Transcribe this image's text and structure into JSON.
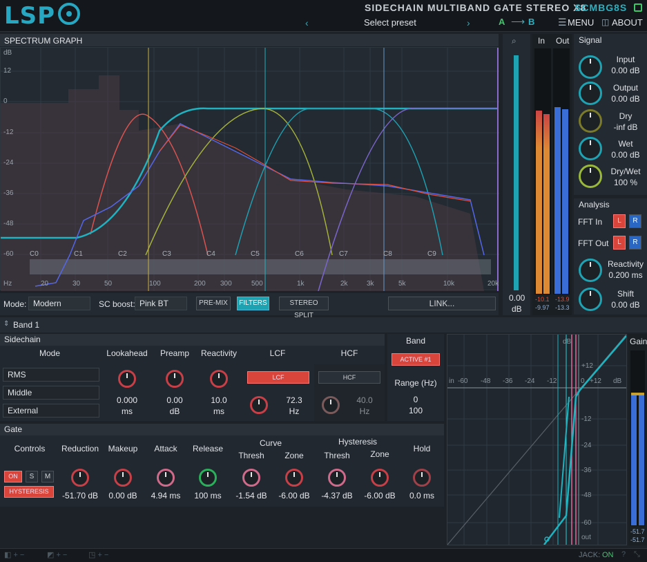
{
  "header": {
    "logo": "LSP",
    "title": "SIDECHAIN MULTIBAND GATE STEREO X8",
    "code": "SCMBG8S",
    "preset": "Select preset",
    "a": "A",
    "b": "B",
    "menu": "MENU",
    "about": "ABOUT"
  },
  "graph": {
    "title": "SPECTRUM GRAPH",
    "db_labels": [
      "dB",
      "12",
      "0",
      "-12",
      "-24",
      "-36",
      "-48",
      "-60"
    ],
    "freq_labels": [
      "Hz",
      "20",
      "30",
      "50",
      "100",
      "200",
      "300",
      "500",
      "1k",
      "2k",
      "3k",
      "5k",
      "10k",
      "20k"
    ],
    "notes": [
      "C0",
      "C1",
      "C2",
      "C3",
      "C4",
      "C5",
      "C6",
      "C7",
      "C8",
      "C9"
    ]
  },
  "controls": {
    "mode_label": "Mode:",
    "mode_value": "Modern",
    "sc_boost_label": "SC boost:",
    "sc_boost_value": "Pink BT",
    "premix": "PRE-MIX",
    "filters": "FILTERS",
    "stereo_split": "STEREO SPLIT",
    "link": "LINK...",
    "out_val": "0.00",
    "out_unit": "dB"
  },
  "meters": {
    "in_label": "In",
    "out_label": "Out",
    "in_vals": [
      "-10.1",
      "-9.97"
    ],
    "out_vals": [
      "-13.9",
      "-13.3"
    ]
  },
  "signal": {
    "title": "Signal",
    "items": [
      {
        "name": "Input",
        "value": "0.00 dB"
      },
      {
        "name": "Output",
        "value": "0.00 dB"
      },
      {
        "name": "Dry",
        "value": "-inf dB"
      },
      {
        "name": "Wet",
        "value": "0.00 dB"
      },
      {
        "name": "Dry/Wet",
        "value": "100 %"
      }
    ]
  },
  "analysis": {
    "title": "Analysis",
    "fft_in": "FFT In",
    "fft_out": "FFT Out",
    "l": "L",
    "r": "R",
    "reactivity_label": "Reactivity",
    "reactivity_value": "0.200 ms",
    "shift_label": "Shift",
    "shift_value": "0.00 dB"
  },
  "band": {
    "label": "Band 1",
    "sidechain_title": "Sidechain",
    "band_title": "Band",
    "active_btn": "ACTIVE #1",
    "range_label": "Range (Hz)",
    "range_lo": "0",
    "range_hi": "100",
    "mode_col": "Mode",
    "mode_opts": [
      "RMS",
      "Middle",
      "External"
    ],
    "sc_knobs": [
      {
        "label": "Lookahead",
        "value": "0.000",
        "unit": "ms"
      },
      {
        "label": "Preamp",
        "value": "0.00",
        "unit": "dB"
      },
      {
        "label": "Reactivity",
        "value": "10.0",
        "unit": "ms"
      }
    ],
    "lcf_label": "LCF",
    "lcf_btn": "LCF",
    "lcf_value": "72.3",
    "lcf_unit": "Hz",
    "hcf_label": "HCF",
    "hcf_btn": "HCF",
    "hcf_value": "40.0",
    "hcf_unit": "Hz"
  },
  "gate": {
    "title": "Gate",
    "controls_label": "Controls",
    "on": "ON",
    "s": "S",
    "m": "M",
    "hysteresis_btn": "HYSTERESIS",
    "curve_label": "Curve",
    "hyst_label": "Hysteresis",
    "knobs": [
      {
        "label": "Reduction",
        "value": "-51.70 dB"
      },
      {
        "label": "Makeup",
        "value": "0.00 dB"
      },
      {
        "label": "Attack",
        "value": "4.94 ms"
      },
      {
        "label": "Release",
        "value": "100 ms"
      },
      {
        "label": "Thresh",
        "value": "-1.54 dB"
      },
      {
        "label": "Zone",
        "value": "-6.00 dB"
      },
      {
        "label": "Thresh",
        "value": "-4.37 dB"
      },
      {
        "label": "Zone",
        "value": "-6.00 dB"
      },
      {
        "label": "Hold",
        "value": "0.0 ms"
      }
    ]
  },
  "curve": {
    "db": "dB",
    "in": "in",
    "out": "out",
    "x_ticks": [
      "-60",
      "-48",
      "-36",
      "-24",
      "-12",
      "0",
      "+12"
    ],
    "y_ticks": [
      "+12",
      "-12",
      "-24",
      "-36",
      "-48",
      "-60"
    ],
    "gain_label": "Gain",
    "gain_vals": [
      "-51.7",
      "-51.7"
    ]
  },
  "footer": {
    "jack_label": "JACK:",
    "jack_value": "ON"
  }
}
